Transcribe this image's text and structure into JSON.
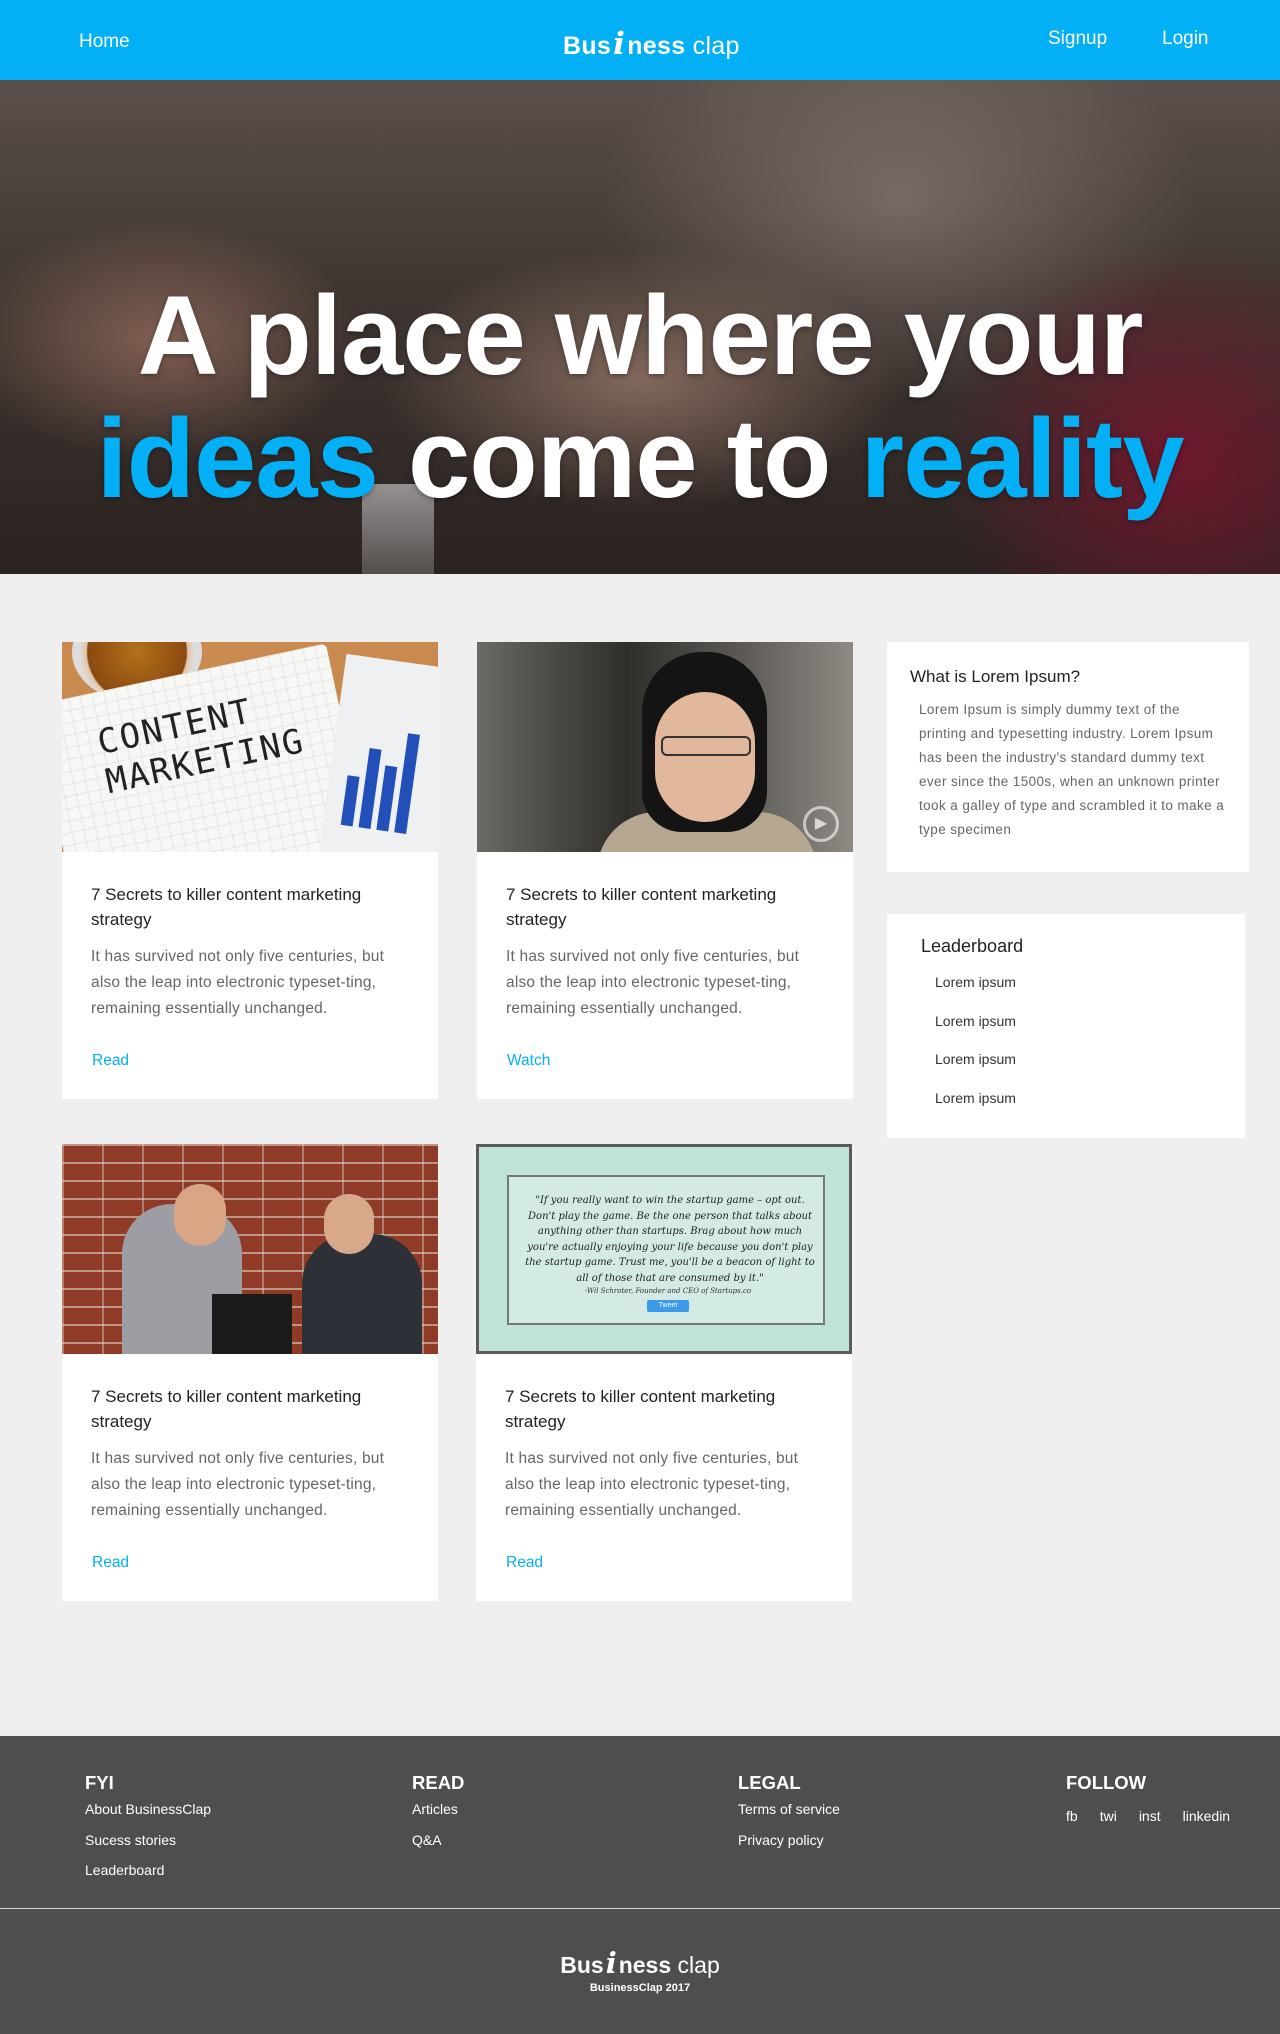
{
  "nav": {
    "home": "Home",
    "brand_part1": "Bus",
    "brand_i": "i",
    "brand_part2": "ness",
    "brand_part3": "clap",
    "signup": "Signup",
    "login": "Login"
  },
  "hero": {
    "line1": "A place where your",
    "line2_accent1": "ideas",
    "line2_middle": " come to ",
    "line2_accent2": "reality"
  },
  "cards": [
    {
      "image": "content-marketing-photo",
      "image_text_line1": "CONTENT",
      "image_text_line2": "MARKETING",
      "title": "7 Secrets to killer content marketing strategy",
      "description": "It has survived not only five centuries, but also the leap into electronic typeset-ting, remaining essentially unchanged.",
      "link": "Read"
    },
    {
      "image": "woman-video-thumbnail",
      "play_icon": "play-icon",
      "title": "7 Secrets to killer content marketing strategy",
      "description": "It has survived not only five centuries, but also the leap into electronic typeset-ting, remaining essentially unchanged.",
      "link": "Watch"
    },
    {
      "image": "men-with-laptops-photo",
      "title": "7 Secrets to killer content marketing strategy",
      "description": "It has survived not only five centuries, but also the leap into electronic typeset-ting, remaining essentially unchanged.",
      "link": "Read"
    },
    {
      "image": "startup-quote-board",
      "quote": "\"If you really want to win the startup game – opt out. Don't play the game. Be the one person that talks about anything other than startups. Brag about how much you're actually enjoying your life because you don't play the startup game. Trust me, you'll be a beacon of light to all of those that are consumed by it.\"",
      "attribution": "-Wil Schroter, Founder and CEO of Startups.co",
      "tweet": "Tweet",
      "title": "7 Secrets to killer content marketing strategy",
      "description": "It has survived not only five centuries, but also the leap into electronic typeset-ting, remaining essentially unchanged.",
      "link": "Read"
    }
  ],
  "sidebar": {
    "about_title": "What is Lorem Ipsum?",
    "about_text": "Lorem Ipsum is simply dummy text of the printing and typesetting industry. Lorem Ipsum has been the industry's standard dummy text ever since the 1500s, when an unknown printer took a galley of type and scrambled it to make a type specimen",
    "leaderboard_title": "Leaderboard",
    "leaderboard_items": [
      "Lorem ipsum",
      "Lorem ipsum",
      "Lorem ipsum",
      "Lorem ipsum"
    ]
  },
  "footer": {
    "columns": [
      {
        "heading": "FYI",
        "links": [
          "About BusinessClap",
          "Sucess stories",
          "Leaderboard"
        ]
      },
      {
        "heading": "READ",
        "links": [
          "Articles",
          "Q&A"
        ]
      },
      {
        "heading": "LEGAL",
        "links": [
          "Terms of service",
          "Privacy policy"
        ]
      },
      {
        "heading": "FOLLOW",
        "links": [
          "fb",
          "twi",
          "inst",
          "linkedin"
        ]
      }
    ],
    "brand_part1": "Bus",
    "brand_i": "i",
    "brand_part2": "ness",
    "brand_part3": "clap",
    "copyright": "BusinessClap 2017"
  },
  "colors": {
    "accent": "#04b0f5",
    "page_bg": "#efefef",
    "footer_bg": "#4e4e4e"
  }
}
